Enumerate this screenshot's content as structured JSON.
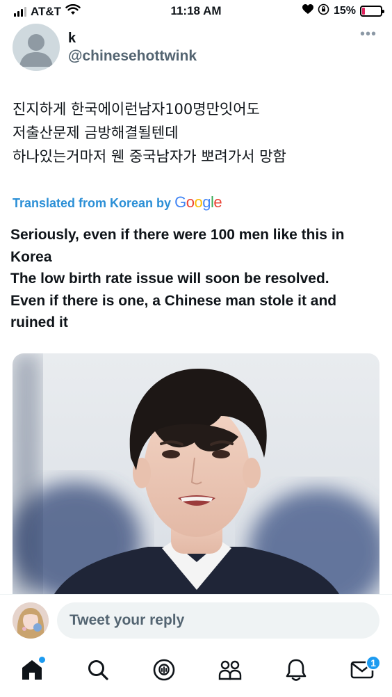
{
  "status_bar": {
    "carrier": "AT&T",
    "time": "11:18 AM",
    "battery_percent": "15%",
    "battery_level": 0.15,
    "icons": [
      "signal-icon",
      "wifi-icon",
      "heart-icon",
      "orientation-lock-icon",
      "battery-icon"
    ]
  },
  "tweet": {
    "author_name": "k",
    "author_handle": "@chinesehottwink",
    "more_label": "•••",
    "text_lines": [
      "진지하게 한국에이런남자100명만잇어도",
      "저출산문제 금방해결될텐데",
      "하나있는거마저 웬 중국남자가 뽀려가서 망함"
    ],
    "translated_prefix": "Translated from Korean by",
    "google_letters": [
      "G",
      "o",
      "o",
      "g",
      "l",
      "e"
    ],
    "translation_lines": [
      "Seriously, even if there were 100 men like this in",
      "Korea",
      "The low birth rate issue will soon be resolved.",
      "Even if there is one, a Chinese man stole it and",
      "ruined it"
    ]
  },
  "reply": {
    "placeholder": "Tweet your reply"
  },
  "nav": {
    "items": [
      "home-icon",
      "search-icon",
      "spaces-icon",
      "communities-icon",
      "notifications-icon",
      "messages-icon"
    ],
    "messages_badge": "1"
  },
  "colors": {
    "translate_link": "#2b8fd6",
    "accent": "#1d9bf0",
    "battery_low": "#e0245e"
  }
}
